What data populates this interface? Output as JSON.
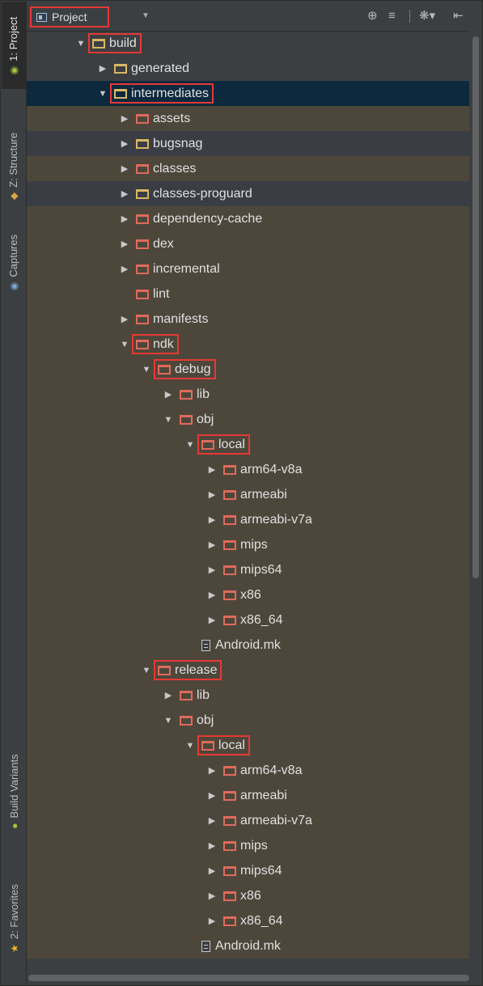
{
  "header": {
    "view_label": "Project",
    "view_icon": "project-view-icon",
    "dropdown_glyph": "▼",
    "icons": [
      "locate-icon",
      "collapse-all-icon",
      "settings-icon",
      "hide-panel-icon"
    ]
  },
  "left_strip": {
    "tabs": [
      {
        "id": "project",
        "label": "1: Project",
        "icon": "android-icon",
        "active": true
      },
      {
        "id": "structure",
        "label": "Z: Structure",
        "icon": "structure-icon",
        "active": false
      },
      {
        "id": "captures",
        "label": "Captures",
        "icon": "camera-icon",
        "active": false
      },
      {
        "id": "build-variants",
        "label": "Build Variants",
        "icon": "android-icon",
        "active": false
      },
      {
        "id": "favorites",
        "label": "2: Favorites",
        "icon": "star-icon",
        "active": false
      }
    ]
  },
  "colors": {
    "background": "#3c3f41",
    "selected_row": "#0d293e",
    "olive_band": "#4d473b",
    "highlight_box": "#e53935",
    "folder_yellow": "#d9b763",
    "folder_red": "#e06a5c",
    "text": "#e0e0e0"
  },
  "tree": {
    "rows": [
      {
        "label": "build",
        "icon": "folder-yellow",
        "arrow": "open",
        "boxed": true
      },
      {
        "label": "generated",
        "icon": "folder-yellow",
        "arrow": "closed",
        "boxed": false
      },
      {
        "label": "intermediates",
        "icon": "folder-yellow",
        "arrow": "open",
        "boxed": true,
        "selected": true
      },
      {
        "label": "assets",
        "icon": "folder-red",
        "arrow": "closed",
        "boxed": false,
        "band": "olive"
      },
      {
        "label": "bugsnag",
        "icon": "folder-yellow",
        "arrow": "closed",
        "boxed": false,
        "band": "dark"
      },
      {
        "label": "classes",
        "icon": "folder-red",
        "arrow": "closed",
        "boxed": false,
        "band": "olive"
      },
      {
        "label": "classes-proguard",
        "icon": "folder-yellow",
        "arrow": "closed",
        "boxed": false,
        "band": "dark"
      },
      {
        "label": "dependency-cache",
        "icon": "folder-red",
        "arrow": "closed",
        "boxed": false,
        "band": "olive"
      },
      {
        "label": "dex",
        "icon": "folder-red",
        "arrow": "closed",
        "boxed": false,
        "band": "olive"
      },
      {
        "label": "incremental",
        "icon": "folder-red",
        "arrow": "closed",
        "boxed": false,
        "band": "olive"
      },
      {
        "label": "lint",
        "icon": "folder-red",
        "arrow": "none",
        "boxed": false,
        "band": "olive"
      },
      {
        "label": "manifests",
        "icon": "folder-red",
        "arrow": "closed",
        "boxed": false,
        "band": "olive"
      },
      {
        "label": "ndk",
        "icon": "folder-red",
        "arrow": "open",
        "boxed": true,
        "band": "olive"
      },
      {
        "label": "debug",
        "icon": "folder-red",
        "arrow": "open",
        "boxed": true,
        "band": "olive"
      },
      {
        "label": "lib",
        "icon": "folder-red",
        "arrow": "closed",
        "boxed": false,
        "band": "olive"
      },
      {
        "label": "obj",
        "icon": "folder-red",
        "arrow": "open",
        "boxed": false,
        "band": "olive"
      },
      {
        "label": "local",
        "icon": "folder-red",
        "arrow": "open",
        "boxed": true,
        "band": "olive"
      },
      {
        "label": "arm64-v8a",
        "icon": "folder-red",
        "arrow": "closed",
        "boxed": false,
        "band": "olive"
      },
      {
        "label": "armeabi",
        "icon": "folder-red",
        "arrow": "closed",
        "boxed": false,
        "band": "olive"
      },
      {
        "label": "armeabi-v7a",
        "icon": "folder-red",
        "arrow": "closed",
        "boxed": false,
        "band": "olive"
      },
      {
        "label": "mips",
        "icon": "folder-red",
        "arrow": "closed",
        "boxed": false,
        "band": "olive"
      },
      {
        "label": "mips64",
        "icon": "folder-red",
        "arrow": "closed",
        "boxed": false,
        "band": "olive"
      },
      {
        "label": "x86",
        "icon": "folder-red",
        "arrow": "closed",
        "boxed": false,
        "band": "olive"
      },
      {
        "label": "x86_64",
        "icon": "folder-red",
        "arrow": "closed",
        "boxed": false,
        "band": "olive"
      },
      {
        "label": "Android.mk",
        "icon": "file",
        "arrow": "none",
        "boxed": false,
        "band": "olive"
      },
      {
        "label": "release",
        "icon": "folder-red",
        "arrow": "open",
        "boxed": true,
        "band": "olive"
      },
      {
        "label": "lib",
        "icon": "folder-red",
        "arrow": "closed",
        "boxed": false,
        "band": "olive"
      },
      {
        "label": "obj",
        "icon": "folder-red",
        "arrow": "open",
        "boxed": false,
        "band": "olive"
      },
      {
        "label": "local",
        "icon": "folder-red",
        "arrow": "open",
        "boxed": true,
        "band": "olive"
      },
      {
        "label": "arm64-v8a",
        "icon": "folder-red",
        "arrow": "closed",
        "boxed": false,
        "band": "olive"
      },
      {
        "label": "armeabi",
        "icon": "folder-red",
        "arrow": "closed",
        "boxed": false,
        "band": "olive"
      },
      {
        "label": "armeabi-v7a",
        "icon": "folder-red",
        "arrow": "closed",
        "boxed": false,
        "band": "olive"
      },
      {
        "label": "mips",
        "icon": "folder-red",
        "arrow": "closed",
        "boxed": false,
        "band": "olive"
      },
      {
        "label": "mips64",
        "icon": "folder-red",
        "arrow": "closed",
        "boxed": false,
        "band": "olive"
      },
      {
        "label": "x86",
        "icon": "folder-red",
        "arrow": "closed",
        "boxed": false,
        "band": "olive"
      },
      {
        "label": "x86_64",
        "icon": "folder-red",
        "arrow": "closed",
        "boxed": false,
        "band": "olive"
      },
      {
        "label": "Android.mk",
        "icon": "file",
        "arrow": "none",
        "boxed": false,
        "band": "olive"
      }
    ]
  }
}
